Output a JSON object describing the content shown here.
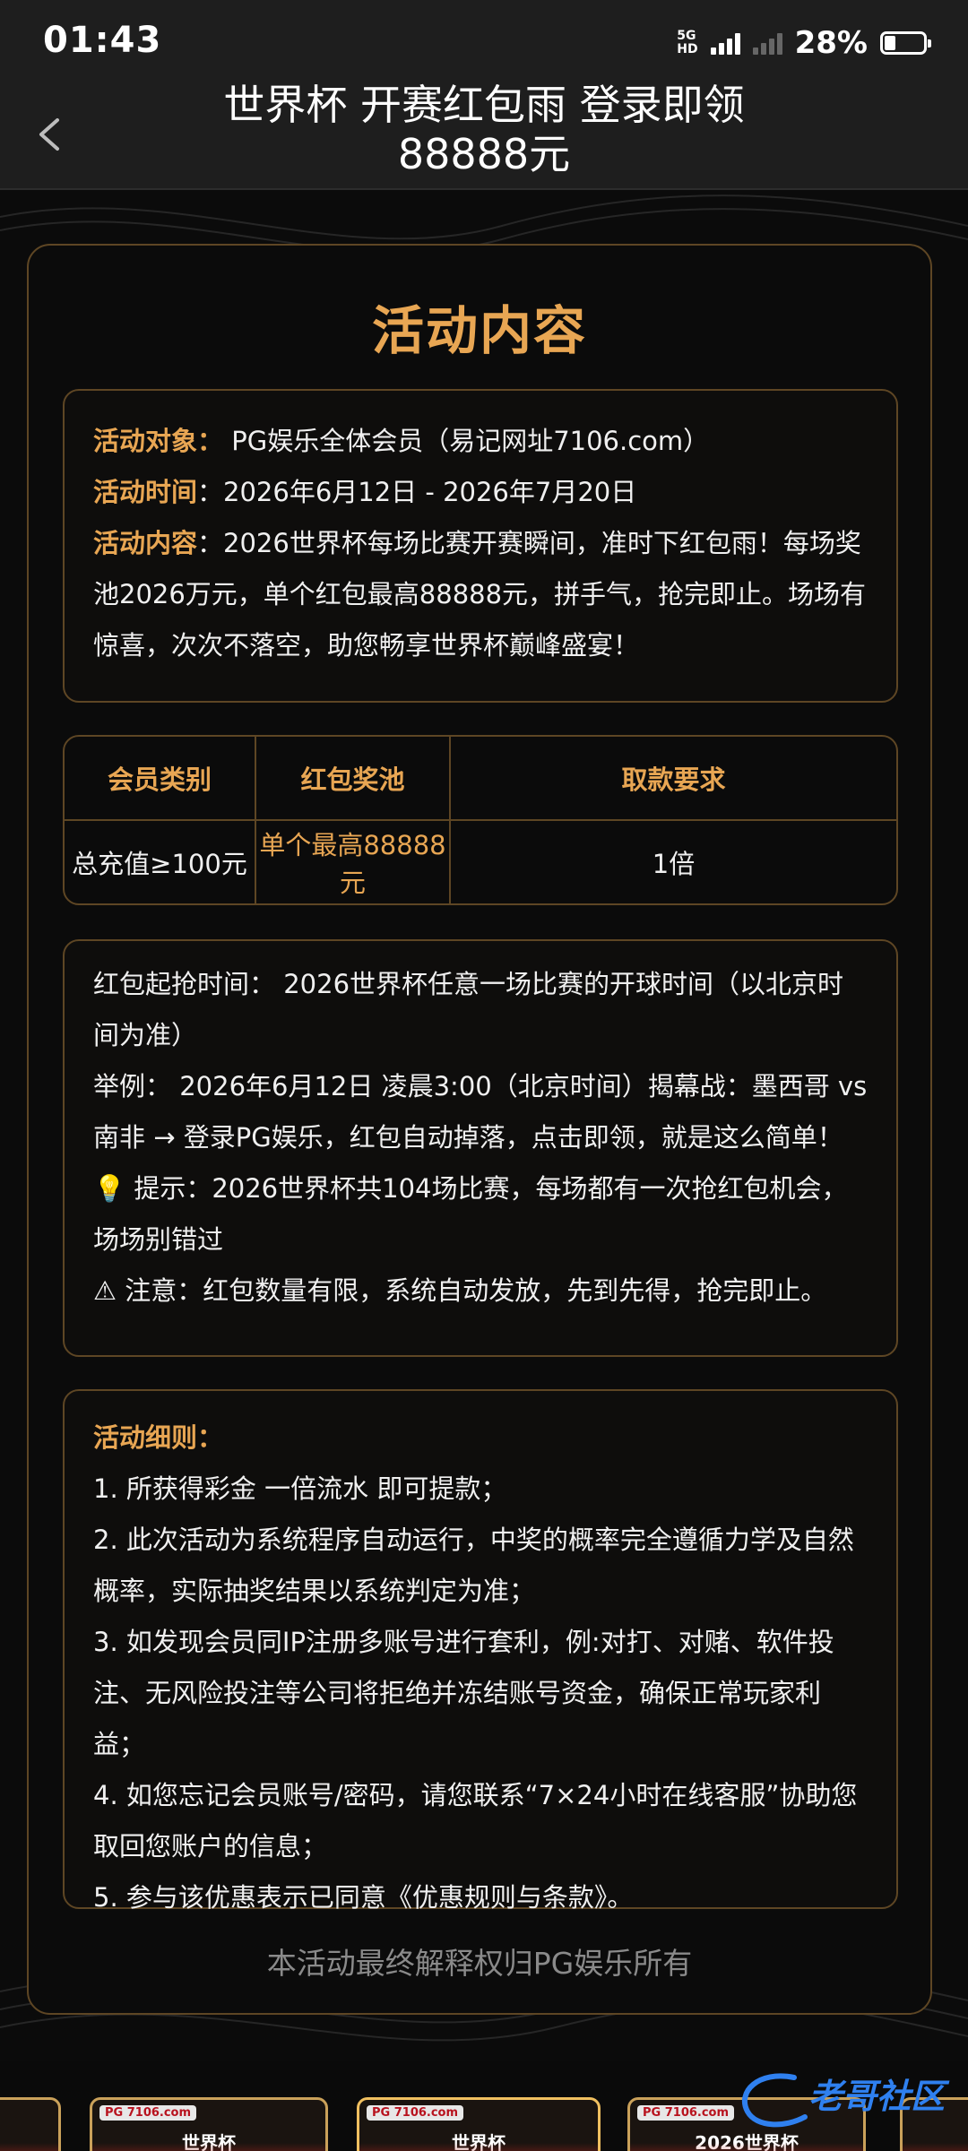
{
  "status_bar": {
    "time": "01:43",
    "network_top": "5G",
    "network_hd": "HD",
    "battery": "28%"
  },
  "header": {
    "title_line1": "世界杯 开赛红包雨 登录即领",
    "title_line2": "88888元"
  },
  "card": {
    "heading": "活动内容",
    "intro": {
      "target_label": "活动对象：",
      "target_value": " PG娱乐全体会员（易记网址7106.com）",
      "time_label": "活动时间",
      "time_value": "：2026年6月12日 - 2026年7月20日",
      "content_label": "活动内容",
      "content_value": "：2026世界杯每场比赛开赛瞬间，准时下红包雨！每场奖池2026万元，单个红包最高88888元，拼手气，抢完即止。场场有惊喜，次次不落空，助您畅享世界杯巅峰盛宴！"
    },
    "table": {
      "headers": [
        "会员类别",
        "红包奖池",
        "取款要求"
      ],
      "row": [
        "总充值≥100元",
        "单个最高88888元",
        "1倍"
      ]
    },
    "info": {
      "start_time": "红包起抢时间： 2026世界杯任意一场比赛的开球时间（以北京时间为准）",
      "example": "举例： 2026年6月12日 凌晨3:00（北京时间）揭幕战：墨西哥 vs 南非 → 登录PG娱乐，红包自动掉落，点击即领，就是这么简单！",
      "tip_icon": "💡",
      "tip": " 提示：2026世界杯共104场比赛，每场都有一次抢红包机会，场场别错过",
      "notice_icon": "⚠",
      "notice": " 注意：红包数量有限，系统自动发放，先到先得，抢完即止。"
    },
    "rules": {
      "title": "活动细则：",
      "items": [
        "1. 所获得彩金 一倍流水 即可提款；",
        "2. 此次活动为系统程序自动运行，中奖的概率完全遵循力学及自然概率，实际抽奖结果以系统判定为准；",
        "3. 如发现会员同IP注册多账号进行套利，例:对打、对赌、软件投注、无风险投注等公司将拒绝并冻结账号资金，确保正常玩家利益；",
        "4. 如您忘记会员账号/密码，请您联系“7×24小时在线客服”协助您取回您账户的信息；",
        "5. 参与该优惠表示已同意《优惠规则与条款》。"
      ]
    },
    "footer": "本活动最终解释权归PG娱乐所有"
  },
  "banners": [
    {
      "tag": "PG 7106.com",
      "name": "世界杯"
    },
    {
      "tag": "PG 7106.com",
      "name": "世界杯"
    },
    {
      "tag": "PG 7106.com",
      "name": "2026世界杯"
    }
  ],
  "watermark": "老哥社区"
}
